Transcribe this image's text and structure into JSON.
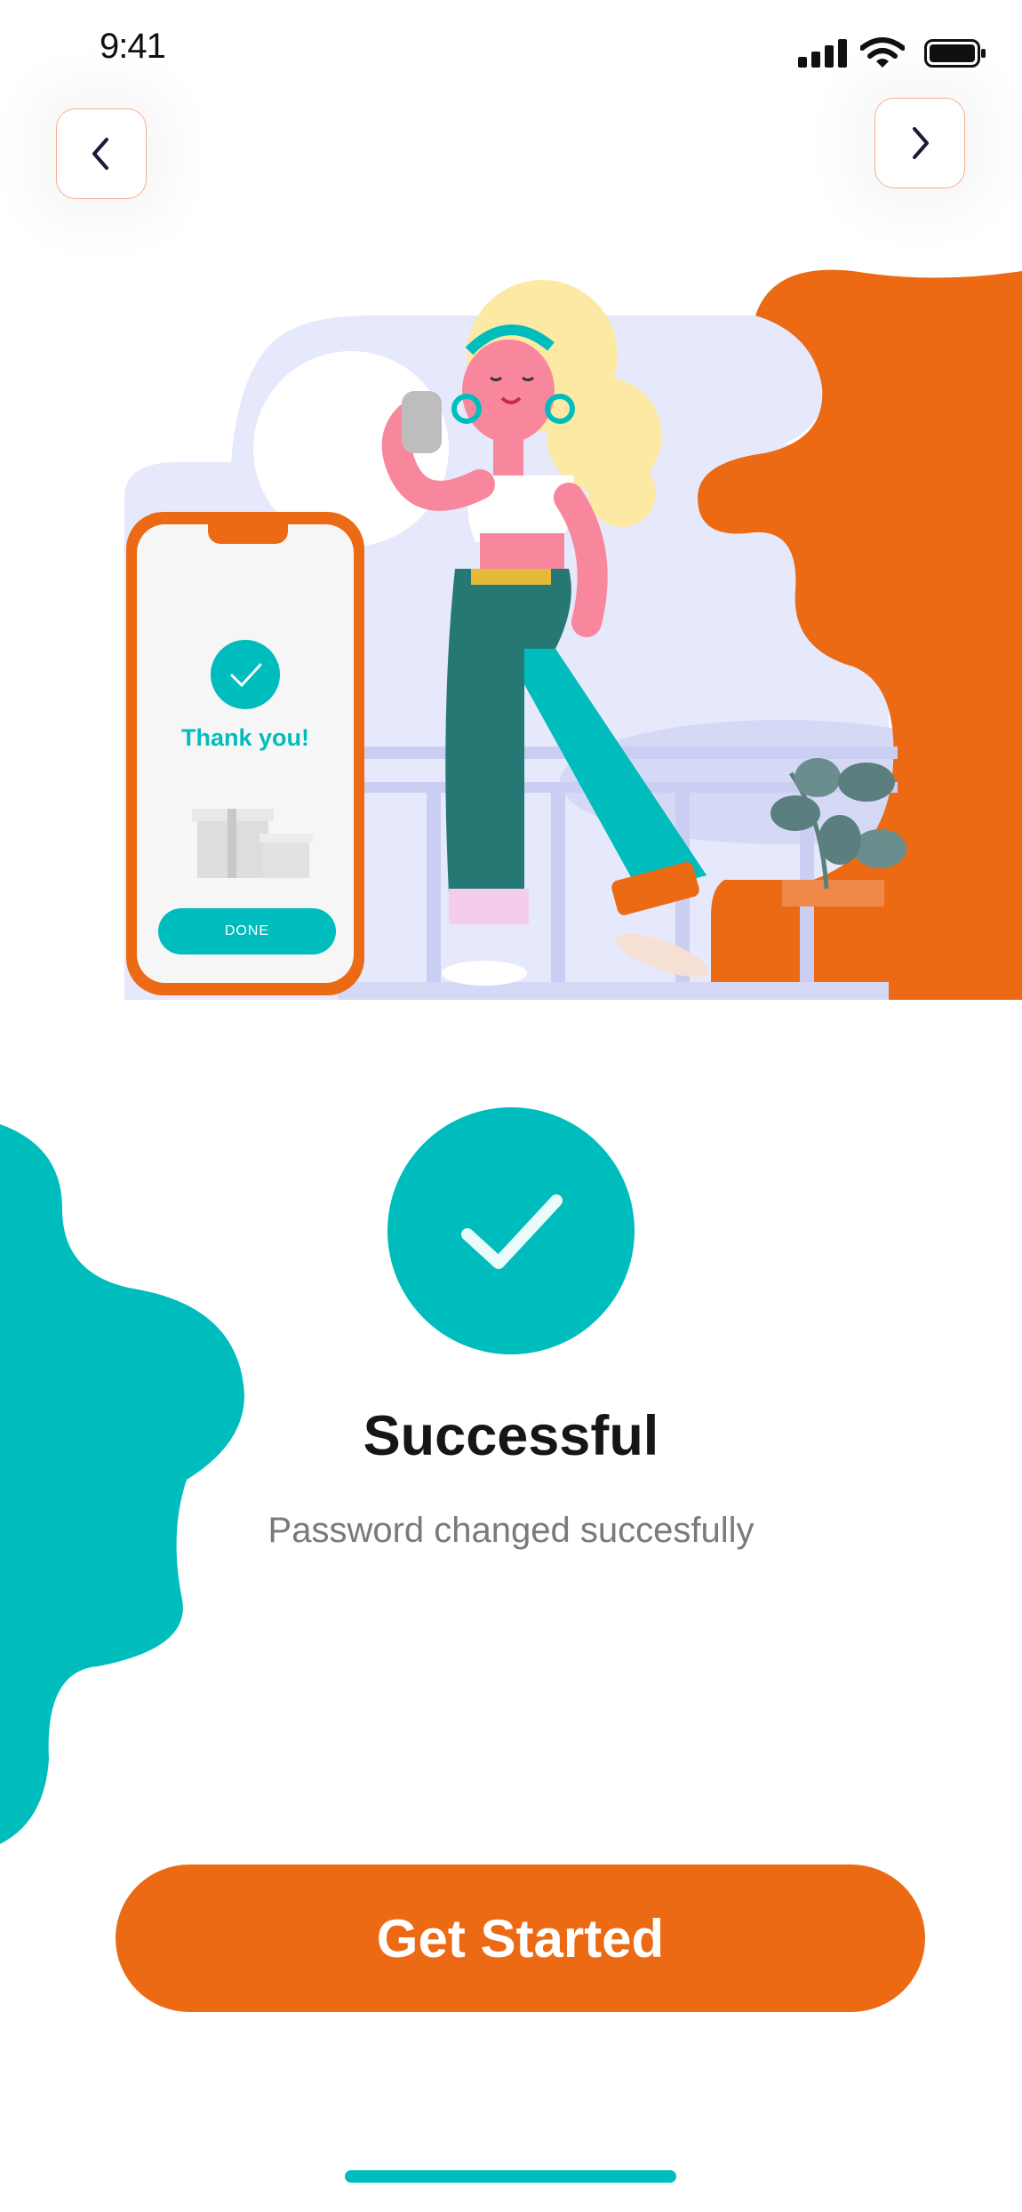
{
  "status_bar": {
    "time": "9:41",
    "icons": [
      "signal-icon",
      "wifi-icon",
      "battery-icon"
    ]
  },
  "nav": {
    "back_icon": "chevron-left-icon",
    "next_icon": "chevron-right-icon"
  },
  "illustration": {
    "phone_screen": {
      "heading": "Thank you!",
      "button_label": "DONE"
    }
  },
  "main": {
    "title": "Successful",
    "subtitle": "Password changed succesfully",
    "cta_label": "Get Started"
  },
  "colors": {
    "accent_orange": "#EC6A13",
    "accent_teal": "#00BDBD",
    "lavender": "#E4E6FB"
  }
}
